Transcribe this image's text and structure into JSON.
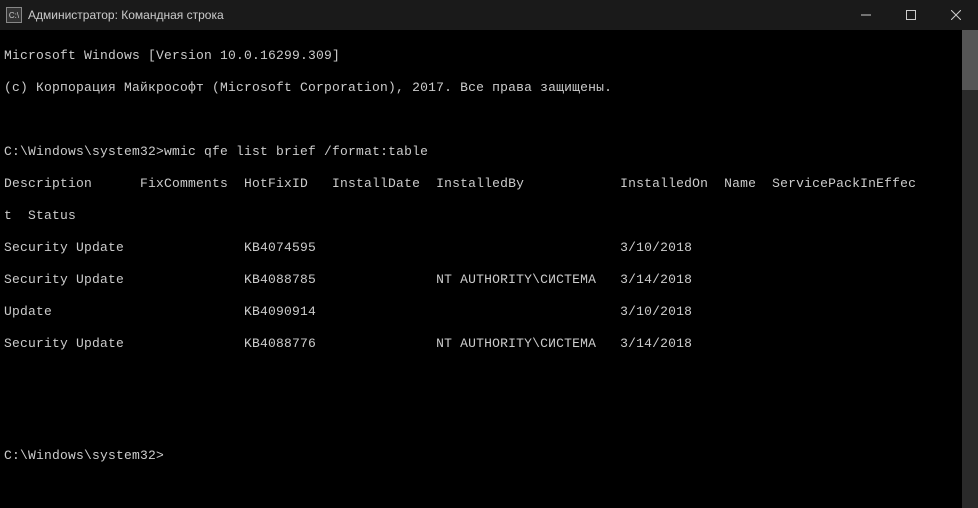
{
  "window": {
    "icon_label": "C:\\",
    "title": "Администратор: Командная строка"
  },
  "terminal": {
    "banner_line1": "Microsoft Windows [Version 10.0.16299.309]",
    "banner_line2": "(c) Корпорация Майкрософт (Microsoft Corporation), 2017. Все права защищены.",
    "prompt_path": "C:\\Windows\\system32>",
    "command": "wmic qfe list brief /format:table",
    "headers": {
      "Description": "Description",
      "FixComments": "FixComments",
      "HotFixID": "HotFixID",
      "InstallDate": "InstallDate",
      "InstalledBy": "InstalledBy",
      "InstalledOn": "InstalledOn",
      "Name": "Name",
      "ServicePackInEffect": "ServicePackInEffec",
      "t": "t",
      "Status": "Status"
    },
    "rows": [
      {
        "Description": "Security Update",
        "HotFixID": "KB4074595",
        "InstalledBy": "",
        "InstalledOn": "3/10/2018"
      },
      {
        "Description": "Security Update",
        "HotFixID": "KB4088785",
        "InstalledBy": "NT AUTHORITY\\СИСТЕМА",
        "InstalledOn": "3/14/2018"
      },
      {
        "Description": "Update",
        "HotFixID": "KB4090914",
        "InstalledBy": "",
        "InstalledOn": "3/10/2018"
      },
      {
        "Description": "Security Update",
        "HotFixID": "KB4088776",
        "InstalledBy": "NT AUTHORITY\\СИСТЕМА",
        "InstalledOn": "3/14/2018"
      }
    ],
    "final_prompt": "C:\\Windows\\system32>"
  }
}
